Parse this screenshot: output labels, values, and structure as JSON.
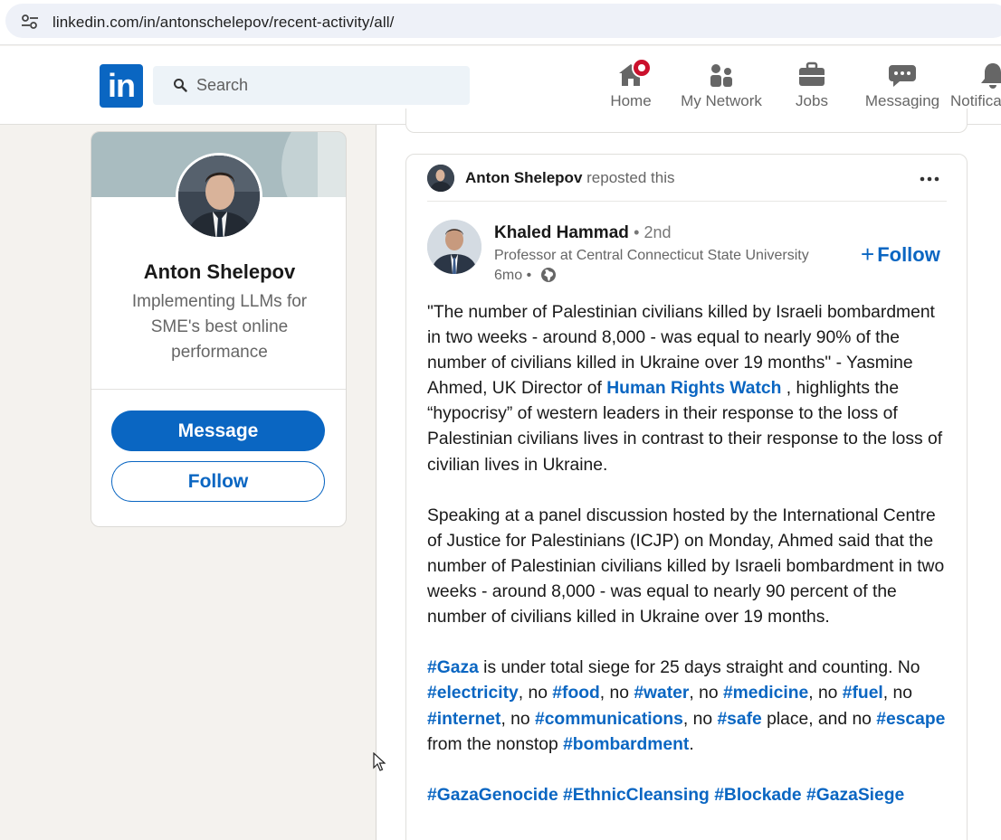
{
  "browser": {
    "url": "linkedin.com/in/antonschelepov/recent-activity/all/"
  },
  "nav": {
    "logo_text": "in",
    "search_placeholder": "Search",
    "items": [
      {
        "label": "Home",
        "icon": "home-icon",
        "badge": true
      },
      {
        "label": "My Network",
        "icon": "people-icon",
        "badge": false
      },
      {
        "label": "Jobs",
        "icon": "briefcase-icon",
        "badge": false
      },
      {
        "label": "Messaging",
        "icon": "messaging-icon",
        "badge": false
      },
      {
        "label": "Notifica",
        "icon": "bell-icon",
        "badge": false
      }
    ],
    "accent": "#0a66c2",
    "badge_color": "#cb112d"
  },
  "profile": {
    "name": "Anton Shelepov",
    "headline": "Implementing LLMs for SME's best online performance",
    "message_label": "Message",
    "follow_label": "Follow"
  },
  "post": {
    "reposter": "Anton Shelepov",
    "repost_suffix": "reposted this",
    "author": {
      "name": "Khaled Hammad",
      "degree": "• 2nd",
      "headline": "Professor at Central Connecticut State University",
      "time": "6mo •"
    },
    "follow_label": "Follow",
    "body": {
      "p1_a": "\"The number of Palestinian civilians killed by Israeli bombardment in two weeks - around 8,000 - was equal to nearly 90% of the number of civilians killed in Ukraine over 19 months\" - Yasmine Ahmed, UK Director of ",
      "p1_mention": "Human Rights Watch",
      "p1_b": " , highlights the “hypocrisy” of western leaders in their response to the loss of Palestinian civilians lives in contrast to their response to the loss of civilian lives in Ukraine.",
      "p2": "Speaking at a panel discussion hosted by the International Centre of Justice for Palestinians (ICJP) on Monday, Ahmed said that the number of Palestinian civilians killed by Israeli bombardment in two weeks - around 8,000 - was equal to nearly 90 percent of the number of civilians killed in Ukraine over 19 months.",
      "p3": {
        "t_gaza": "#Gaza",
        "s1": " is under total siege for 25 days straight and counting. No ",
        "t_electricity": "#electricity",
        "s2": ", no ",
        "t_food": "#food",
        "s3": ", no ",
        "t_water": "#water",
        "s4": ", no ",
        "t_medicine": "#medicine",
        "s5": ", no ",
        "t_fuel": "#fuel",
        "s6": ", no ",
        "t_internet": "#internet",
        "s7": ", no ",
        "t_communications": "#communications",
        "s8": ", no ",
        "t_safe": "#safe",
        "s9": " place, and no ",
        "t_escape": "#escape",
        "s10": " from the nonstop ",
        "t_bombardment": "#bombardment",
        "s11": "."
      },
      "p4": [
        "#GazaGenocide",
        "#EthnicCleansing",
        "#Blockade",
        "#GazaSiege"
      ]
    }
  }
}
